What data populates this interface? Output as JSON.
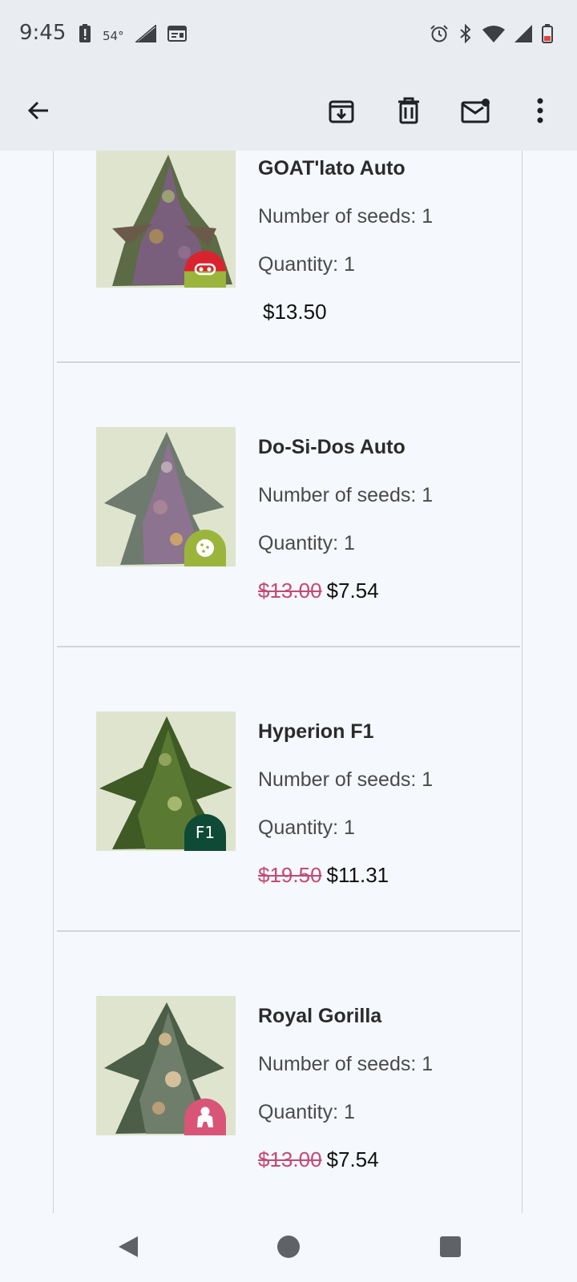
{
  "status_bar": {
    "time": "9:45",
    "temperature": "54°",
    "icons_left": [
      "alert-battery-icon",
      "weather-icon",
      "no-signal-icon",
      "calendar-icon"
    ],
    "icons_right": [
      "alarm-icon",
      "bluetooth-icon",
      "wifi-icon",
      "cell-signal-icon",
      "battery-low-icon"
    ]
  },
  "app_bar": {
    "icons": [
      "back-arrow-icon",
      "archive-icon",
      "delete-icon",
      "mark-unread-icon",
      "more-vert-icon"
    ]
  },
  "items": [
    {
      "name": "GOAT'lato Auto",
      "seeds": "Number of seeds: 1",
      "quantity": "Quantity: 1",
      "old_price": "",
      "price": "$13.50",
      "badge_icon": "goat-mask-icon",
      "badge_text": "",
      "badge_color": "#d9242f",
      "badge_color_bottom": "#9bb53c"
    },
    {
      "name": "Do-Si-Dos Auto",
      "seeds": "Number of seeds: 1",
      "quantity": "Quantity: 1",
      "old_price": "$13.00",
      "price": "$7.54",
      "badge_icon": "cookie-icon",
      "badge_text": "",
      "badge_color": "#9bb53c"
    },
    {
      "name": "Hyperion F1",
      "seeds": "Number of seeds: 1",
      "quantity": "Quantity: 1",
      "old_price": "$19.50",
      "price": "$11.31",
      "badge_icon": "f1-badge-icon",
      "badge_text": "F1",
      "badge_color": "#0f4a37"
    },
    {
      "name": "Royal Gorilla",
      "seeds": "Number of seeds: 1",
      "quantity": "Quantity: 1",
      "old_price": "$13.00",
      "price": "$7.54",
      "badge_icon": "gorilla-icon",
      "badge_text": "",
      "badge_color": "#d95577"
    }
  ],
  "nav_bar": {
    "icons": [
      "back-triangle-icon",
      "home-circle-icon",
      "recents-square-icon"
    ]
  },
  "colors": {
    "background": "#f5f8fc",
    "bar_background": "#e9edf2",
    "old_price": "#c54a73",
    "divider": "#d1d6da"
  }
}
